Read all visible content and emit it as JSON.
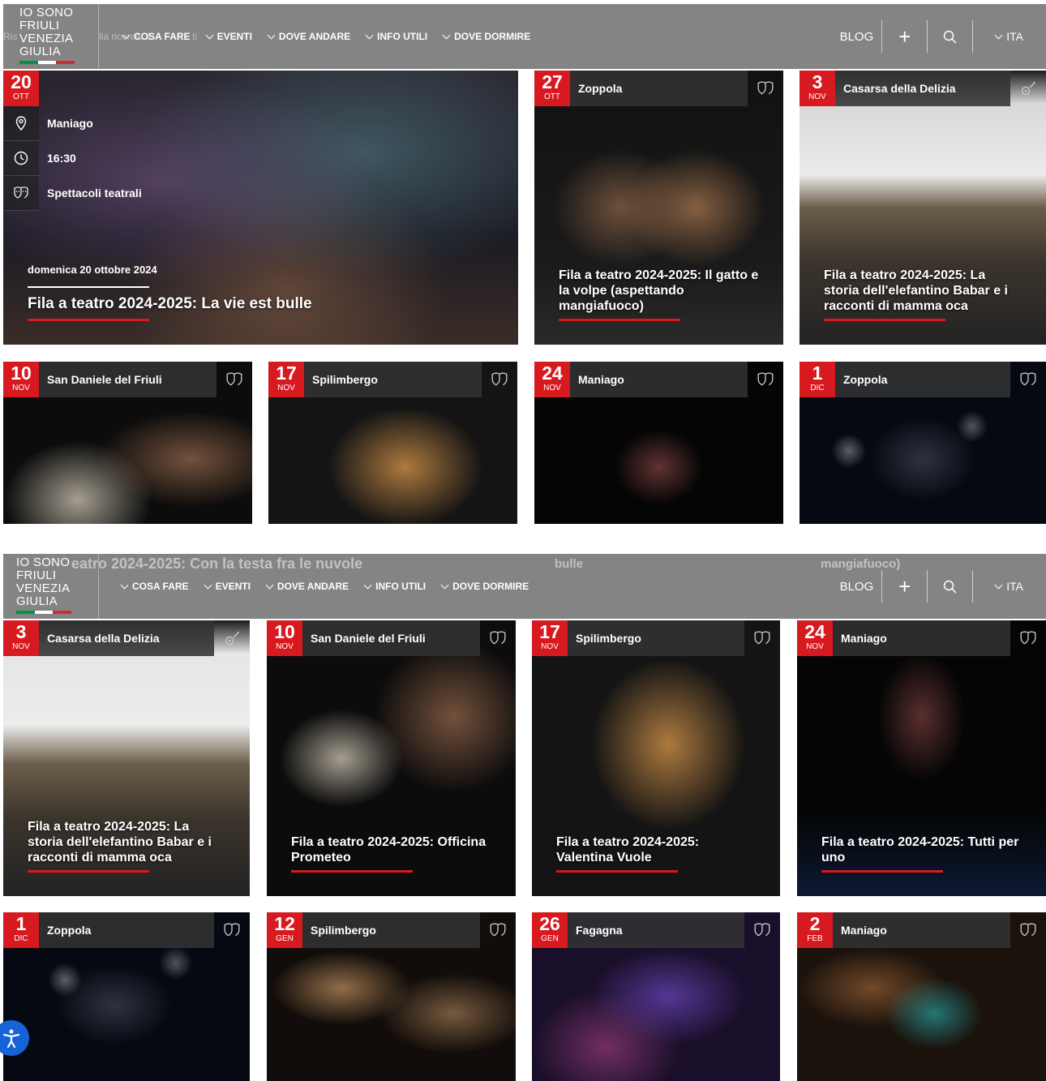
{
  "header": {
    "logo_lines": [
      "IO SONO",
      "FRIULI",
      "VENEZIA",
      "GIULIA"
    ],
    "menu": [
      "COSA FARE",
      "EVENTI",
      "DOVE ANDARE",
      "INFO UTILI",
      "DOVE DORMIRE"
    ],
    "blog": "BLOG",
    "lang": "ITA",
    "flag_colors": [
      "#009246",
      "#ffffff",
      "#ce2b37"
    ]
  },
  "ghost": {
    "search_prefix": "Ris",
    "search_mid": "lla ricerca: 1",
    "search_tail": "ti",
    "title_fragment": "eatro 2024-2025: Con la testa fra le nuvole",
    "bulle_fragment": "bulle",
    "mangiafuoco_fragment": "mangiafuoco)"
  },
  "featured": {
    "day": "20",
    "month": "OTT",
    "location": "Maniago",
    "time": "16:30",
    "category": "Spettacoli teatrali",
    "date_long": "domenica 20 ottobre 2024",
    "title": "Fila a teatro 2024-2025: La vie est bulle"
  },
  "top_cards": [
    {
      "day": "27",
      "month": "OTT",
      "location": "Zoppola",
      "icon": "theater-masks-icon",
      "title": "Fila a teatro 2024-2025: Il gatto e la volpe (aspettando mangiafuoco)"
    },
    {
      "day": "3",
      "month": "NOV",
      "location": "Casarsa della Delizia",
      "icon": "guitar-icon",
      "title": "Fila a teatro 2024-2025: La storia dell'elefantino Babar e i racconti di mamma oca"
    }
  ],
  "row2": [
    {
      "day": "10",
      "month": "NOV",
      "location": "San Daniele del Friuli",
      "icon": "theater-masks-icon"
    },
    {
      "day": "17",
      "month": "NOV",
      "location": "Spilimbergo",
      "icon": "theater-masks-icon"
    },
    {
      "day": "24",
      "month": "NOV",
      "location": "Maniago",
      "icon": "theater-masks-icon"
    },
    {
      "day": "1",
      "month": "DIC",
      "location": "Zoppola",
      "icon": "theater-masks-icon"
    }
  ],
  "row3": [
    {
      "day": "3",
      "month": "NOV",
      "location": "Casarsa della Delizia",
      "icon": "guitar-icon",
      "title": "Fila a teatro 2024-2025: La storia dell'elefantino Babar e i racconti di mamma oca"
    },
    {
      "day": "10",
      "month": "NOV",
      "location": "San Daniele del Friuli",
      "icon": "theater-masks-icon",
      "title": "Fila a teatro 2024-2025: Officina Prometeo"
    },
    {
      "day": "17",
      "month": "NOV",
      "location": "Spilimbergo",
      "icon": "theater-masks-icon",
      "title": "Fila a teatro 2024-2025: Valentina Vuole"
    },
    {
      "day": "24",
      "month": "NOV",
      "location": "Maniago",
      "icon": "theater-masks-icon",
      "title": "Fila a teatro 2024-2025: Tutti per uno"
    }
  ],
  "row4": [
    {
      "day": "1",
      "month": "DIC",
      "location": "Zoppola",
      "icon": "theater-masks-icon"
    },
    {
      "day": "12",
      "month": "GEN",
      "location": "Spilimbergo",
      "icon": "theater-masks-icon"
    },
    {
      "day": "26",
      "month": "GEN",
      "location": "Fagagna",
      "icon": "theater-masks-icon"
    },
    {
      "day": "2",
      "month": "FEB",
      "location": "Maniago",
      "icon": "theater-masks-icon"
    }
  ],
  "colors": {
    "accent": "#d71920",
    "header_bg": "#707070",
    "accessibility": "#1463d8"
  }
}
